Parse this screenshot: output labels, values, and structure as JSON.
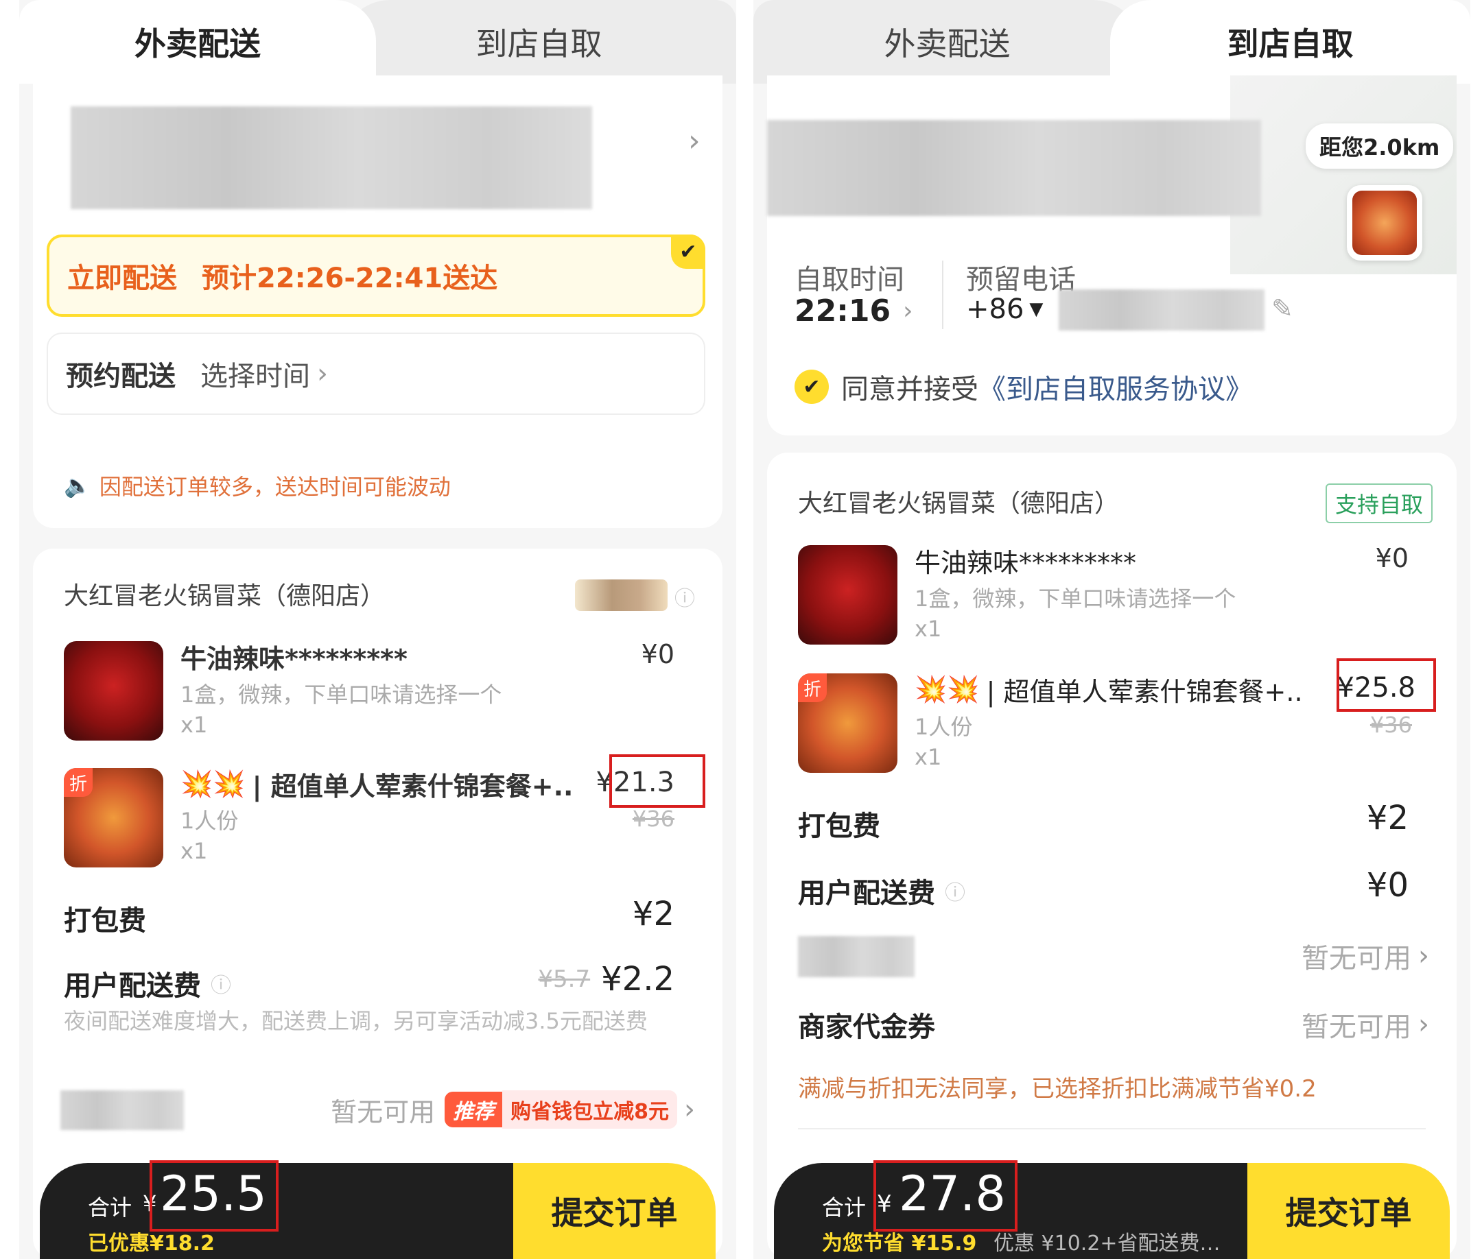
{
  "left": {
    "tabs": {
      "delivery": "外卖配送",
      "pickup": "到店自取"
    },
    "delivery_options": {
      "now_label": "立即配送",
      "now_eta": "预计22:26-22:41送达",
      "schedule_label": "预约配送",
      "schedule_action": "选择时间"
    },
    "notice": "因配送订单较多，送达时间可能波动",
    "store_name": "大红冒老火锅冒菜（德阳店）",
    "items": [
      {
        "name": "牛油辣味*********",
        "desc": "1盒，微辣，下单口味请选择一个",
        "qty": "x1",
        "price": "¥0",
        "orig_price": ""
      },
      {
        "name": "| 超值单人荤素什锦套餐+..",
        "desc": "1人份",
        "qty": "x1",
        "price": "¥21.3",
        "orig_price": "¥36",
        "badge": "折"
      }
    ],
    "packing_fee": {
      "label": "打包费",
      "value": "¥2"
    },
    "delivery_fee": {
      "label": "用户配送费",
      "orig": "¥5.7",
      "value": "¥2.2",
      "note": "夜间配送难度增大，配送费上调，另可享活动减3.5元配送费"
    },
    "coupon": {
      "status": "暂无可用",
      "tag": "推荐",
      "promo": "购省钱包立减8元"
    },
    "footer": {
      "total_label": "合计",
      "currency": "¥",
      "total": "25.5",
      "discount": "已优惠¥18.2",
      "submit": "提交订单"
    }
  },
  "right": {
    "tabs": {
      "delivery": "外卖配送",
      "pickup": "到店自取"
    },
    "distance": "距您2.0km",
    "pickup_time_label": "自取时间",
    "pickup_time": "22:16",
    "phone_label": "预留电话",
    "phone_prefix": "+86",
    "agreement_prefix": "同意并接受",
    "agreement_link": "《到店自取服务协议》",
    "store_name": "大红冒老火锅冒菜（德阳店）",
    "store_tag": "支持自取",
    "items": [
      {
        "name": "牛油辣味*********",
        "desc": "1盒，微辣，下单口味请选择一个",
        "qty": "x1",
        "price": "¥0",
        "orig_price": ""
      },
      {
        "name": "| 超值单人荤素什锦套餐+..",
        "desc": "1人份",
        "qty": "x1",
        "price": "¥25.8",
        "orig_price": "¥36",
        "badge": "折"
      }
    ],
    "packing_fee": {
      "label": "打包费",
      "value": "¥2"
    },
    "delivery_fee": {
      "label": "用户配送费",
      "value": "¥0"
    },
    "platform_coupon": {
      "status": "暂无可用"
    },
    "merchant_coupon": {
      "label": "商家代金券",
      "status": "暂无可用"
    },
    "discount_note": "满减与折扣无法同享，已选择折扣比满减节省¥0.2",
    "footer": {
      "total_label": "合计",
      "currency": "¥",
      "total": "27.8",
      "savings": "为您节省 ¥15.9",
      "savings_detail": "优惠 ¥10.2+省配送费…",
      "submit": "提交订单"
    }
  },
  "colors": {
    "brand_yellow": "#ffdd2e",
    "price_orange": "#e8601c",
    "highlight_red": "#d81e1e",
    "link_blue": "#3a5a8c"
  }
}
